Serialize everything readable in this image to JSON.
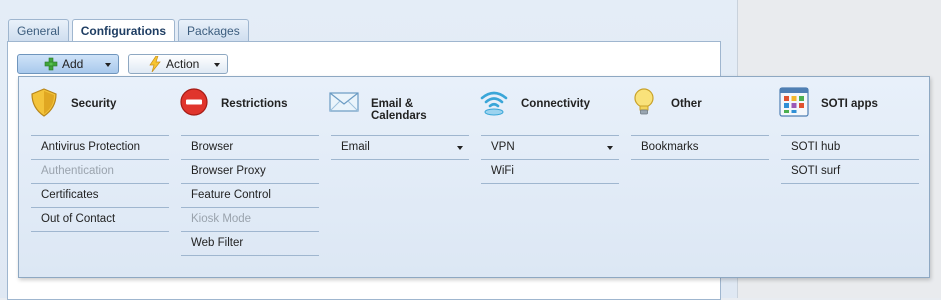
{
  "tabs": [
    {
      "label": "General"
    },
    {
      "label": "Configurations"
    },
    {
      "label": "Packages"
    }
  ],
  "toolbar": {
    "add_label": "Add",
    "action_label": "Action"
  },
  "menu": {
    "columns": [
      {
        "title": "Security",
        "icon": "shield-icon",
        "items": [
          {
            "label": "Antivirus Protection",
            "enabled": true
          },
          {
            "label": "Authentication",
            "enabled": false
          },
          {
            "label": "Certificates",
            "enabled": true
          },
          {
            "label": "Out of Contact",
            "enabled": true
          }
        ]
      },
      {
        "title": "Restrictions",
        "icon": "no-entry-icon",
        "items": [
          {
            "label": "Browser",
            "enabled": true
          },
          {
            "label": "Browser Proxy",
            "enabled": true
          },
          {
            "label": "Feature Control",
            "enabled": true
          },
          {
            "label": "Kiosk Mode",
            "enabled": false
          },
          {
            "label": "Web Filter",
            "enabled": true
          }
        ]
      },
      {
        "title": "Email & Calendars",
        "icon": "envelope-icon",
        "items": [
          {
            "label": "Email",
            "enabled": true,
            "submenu": true
          }
        ]
      },
      {
        "title": "Connectivity",
        "icon": "wifi-icon",
        "items": [
          {
            "label": "VPN",
            "enabled": true,
            "submenu": true
          },
          {
            "label": "WiFi",
            "enabled": true
          }
        ]
      },
      {
        "title": "Other",
        "icon": "lightbulb-icon",
        "items": [
          {
            "label": "Bookmarks",
            "enabled": true
          }
        ]
      },
      {
        "title": "SOTI apps",
        "icon": "app-grid-icon",
        "items": [
          {
            "label": "SOTI hub",
            "enabled": true
          },
          {
            "label": "SOTI surf",
            "enabled": true
          }
        ]
      }
    ]
  }
}
